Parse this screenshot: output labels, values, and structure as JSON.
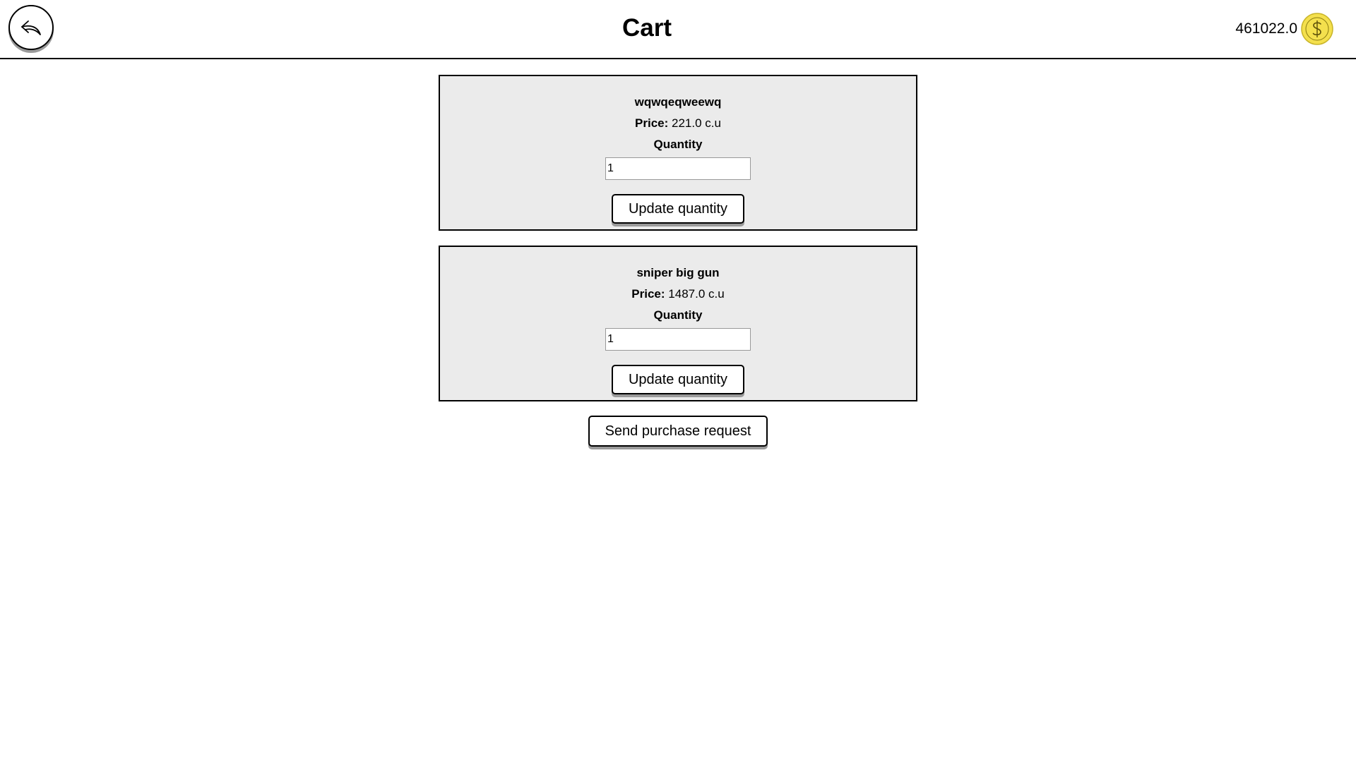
{
  "header": {
    "title": "Cart",
    "back_icon": "back-arrow-icon",
    "balance": "461022.0",
    "coin_icon": "dollar-coin-icon",
    "coin_color": "#f4e04d"
  },
  "cart": {
    "items": [
      {
        "name": "wqwqeqweewq",
        "price_label": "Price:",
        "price_value": "221.0 c.u",
        "quantity_label": "Quantity",
        "quantity": "1",
        "update_label": "Update quantity"
      },
      {
        "name": "sniper big gun",
        "price_label": "Price:",
        "price_value": "1487.0 c.u",
        "quantity_label": "Quantity",
        "quantity": "1",
        "update_label": "Update quantity"
      }
    ],
    "send_label": "Send purchase request"
  }
}
